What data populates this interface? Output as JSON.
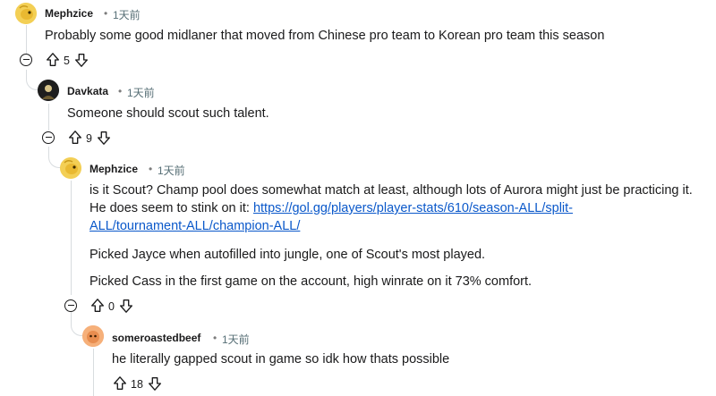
{
  "comments": [
    {
      "author": "Mephzice",
      "separator": "•",
      "time": "1天前",
      "paragraphs": [
        "Probably some good midlaner that moved from Chinese pro team to Korean pro team this season"
      ],
      "score": "5"
    },
    {
      "author": "Davkata",
      "separator": "•",
      "time": "1天前",
      "paragraphs": [
        "Someone should scout such talent."
      ],
      "score": "9"
    },
    {
      "author": "Mephzice",
      "separator": "•",
      "time": "1天前",
      "text_before_link": "is it Scout? Champ pool does somewhat match at least, although lots of Aurora might just be practicing it. He does seem to stink on it: ",
      "link_line1": "https://gol.gg/players/player-stats/610/season-ALL/split-",
      "link_line2": "ALL/tournament-ALL/champion-ALL/",
      "paragraphs": [
        "Picked Jayce when autofilled into jungle, one of Scout's most played.",
        "Picked Cass in the first game on the account, high winrate on it 73% comfort."
      ],
      "score": "0"
    },
    {
      "author": "someroastedbeef",
      "separator": "•",
      "time": "1天前",
      "paragraphs": [
        "he literally gapped scout in game so idk how thats possible"
      ],
      "score": "18"
    }
  ],
  "icons": {
    "collapse": "collapse-thread-icon",
    "upvote": "upvote-arrow-icon",
    "downvote": "downvote-arrow-icon"
  }
}
